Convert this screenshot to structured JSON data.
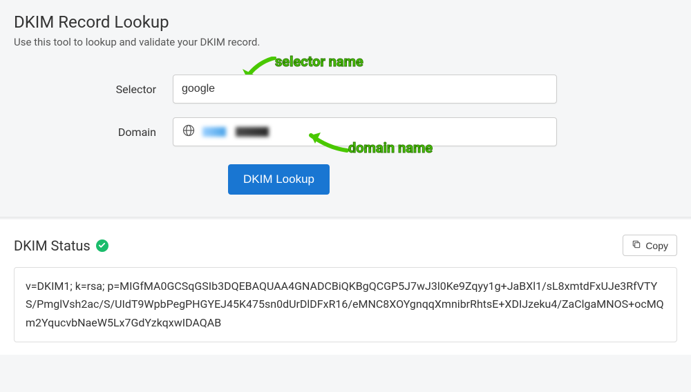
{
  "header": {
    "title": "DKIM Record Lookup",
    "subtitle": "Use this tool to lookup and validate your DKIM record."
  },
  "annotations": {
    "selector_label": "selector name",
    "domain_label": "domain name"
  },
  "form": {
    "selector_label": "Selector",
    "selector_value": "google",
    "domain_label": "Domain",
    "submit_label": "DKIM Lookup"
  },
  "status": {
    "title": "DKIM Status",
    "copy_label": "Copy",
    "record": "v=DKIM1; k=rsa; p=MIGfMA0GCSqGSIb3DQEBAQUAA4GNADCBiQKBgQCGP5J7wJ3l0Ke9Zqyy1g+JaBXl1/sL8xmtdFxUJe3RfVTYS/PmglVsh2ac/S/UIdT9WpbPegPHGYEJ45K475sn0dUrDlDFxR16/eMNC8XOYgnqqXmnibrRhtsE+XDIJzeku4/ZaClgaMNOS+ocMQm2YqucvbNaeW5Lx7GdYzkqxwIDAQAB"
  }
}
